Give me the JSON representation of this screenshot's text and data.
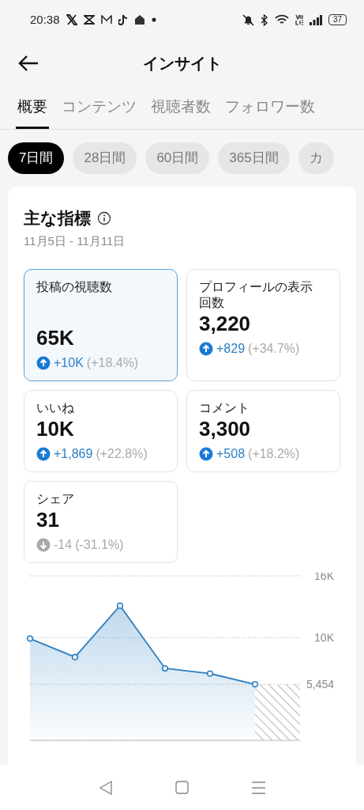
{
  "status_bar": {
    "time": "20:38",
    "battery": "37"
  },
  "header": {
    "title": "インサイト"
  },
  "tabs": [
    {
      "label": "概要",
      "selected": true
    },
    {
      "label": "コンテンツ",
      "selected": false
    },
    {
      "label": "視聴者数",
      "selected": false
    },
    {
      "label": "フォロワー数",
      "selected": false
    }
  ],
  "periods": [
    {
      "label": "7日間",
      "selected": true
    },
    {
      "label": "28日間",
      "selected": false
    },
    {
      "label": "60日間",
      "selected": false
    },
    {
      "label": "365日間",
      "selected": false
    },
    {
      "label": "カ",
      "selected": false
    }
  ],
  "section": {
    "title": "主な指標",
    "date_range": "11月5日 - 11月11日"
  },
  "metrics": [
    {
      "label": "投稿の視聴数",
      "value": "65K",
      "change": "+10K",
      "percent": "(+18.4%)",
      "kind": "up",
      "selected": true
    },
    {
      "label": "プロフィールの表示回数",
      "value": "3,220",
      "change": "+829",
      "percent": "(+34.7%)",
      "kind": "up",
      "selected": false
    },
    {
      "label": "いいね",
      "value": "10K",
      "change": "+1,869",
      "percent": "(+22.8%)",
      "kind": "up",
      "selected": false
    },
    {
      "label": "コメント",
      "value": "3,300",
      "change": "+508",
      "percent": "(+18.2%)",
      "kind": "up",
      "selected": false
    },
    {
      "label": "シェア",
      "value": "31",
      "change": "-14",
      "percent": "(-31.1%)",
      "kind": "down",
      "selected": false
    }
  ],
  "chart": {
    "chart_data": {
      "type": "area",
      "ylim": [
        0,
        16000
      ],
      "yticks": [
        {
          "value": 16000,
          "label": "16K"
        },
        {
          "value": 10000,
          "label": "10K"
        },
        {
          "value": 5454,
          "label": "5,454"
        }
      ],
      "series": [
        {
          "color": "#2d7fc0",
          "values": [
            9900,
            8100,
            13100,
            7000,
            6500,
            5454
          ]
        }
      ]
    }
  }
}
